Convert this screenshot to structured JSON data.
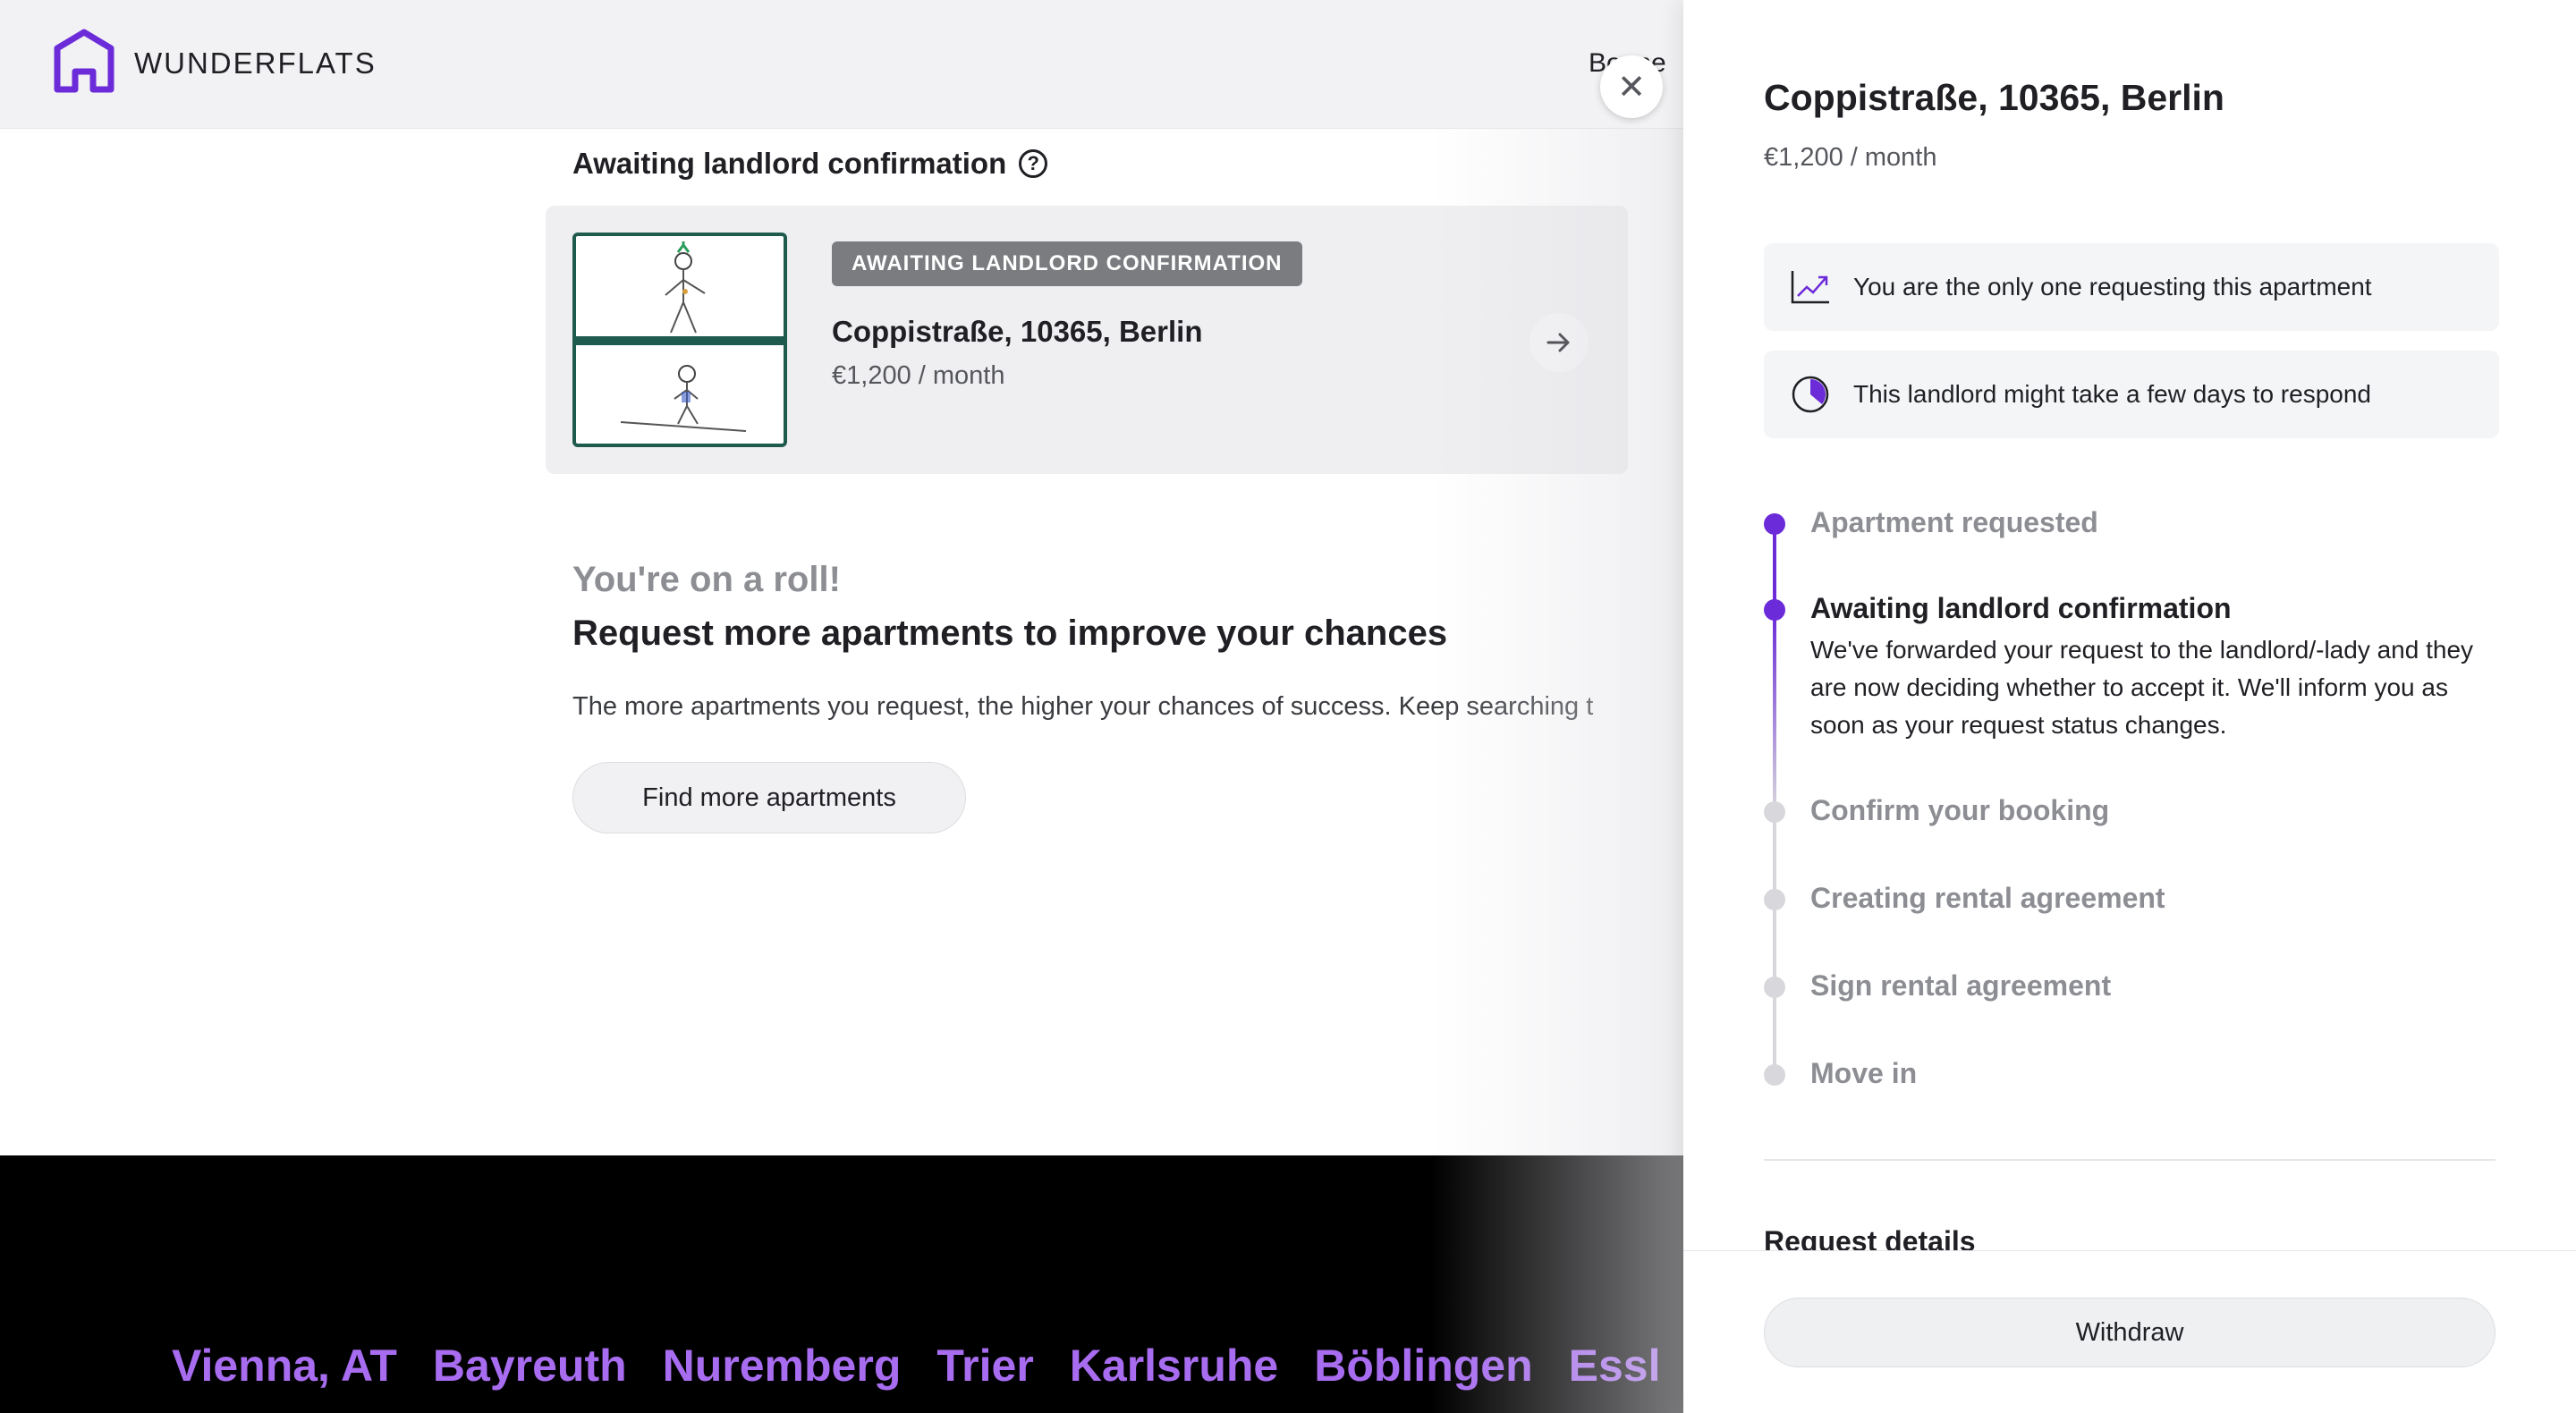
{
  "header": {
    "brand": "WUNDERFLATS",
    "nav_partial": "Bo   me"
  },
  "main": {
    "section_title": "Awaiting landlord confirmation",
    "card": {
      "badge": "AWAITING LANDLORD CONFIRMATION",
      "address": "Coppistraße, 10365, Berlin",
      "price": "€1,200 / month"
    },
    "roll_title": "You're on a roll!",
    "roll_subtitle": "Request more apartments to improve your chances",
    "roll_description": "The more apartments you request, the higher your chances of success. Keep searching t",
    "find_button": "Find more apartments"
  },
  "footer": {
    "cities": [
      "Vienna, AT",
      "Bayreuth",
      "Nuremberg",
      "Trier",
      "Karlsruhe",
      "Böblingen",
      "Essl"
    ]
  },
  "drawer": {
    "close": "✕",
    "title": "Coppistraße, 10365, Berlin",
    "price": "€1,200 / month",
    "info": [
      {
        "icon": "trend-chart-icon",
        "text": "You are the only one requesting this apartment"
      },
      {
        "icon": "clock-icon",
        "text": "This landlord might take a few days to respond"
      }
    ],
    "steps": [
      {
        "label": "Apartment requested",
        "state": "done"
      },
      {
        "label": "Awaiting landlord confirmation",
        "state": "current",
        "description": "We've forwarded your request to the landlord/-lady and they are now deciding whether to accept it. We'll inform you as soon as your request status changes."
      },
      {
        "label": "Confirm your booking",
        "state": "pending"
      },
      {
        "label": "Creating rental agreement",
        "state": "pending"
      },
      {
        "label": "Sign rental agreement",
        "state": "pending"
      },
      {
        "label": "Move in",
        "state": "pending"
      }
    ],
    "request_details": "Request details",
    "withdraw_button": "Withdraw"
  },
  "colors": {
    "accent": "#6c2bd9",
    "city_text": "#a86cf0",
    "badge_bg": "#7a7c80",
    "thumb_border": "#1e5a4e"
  }
}
